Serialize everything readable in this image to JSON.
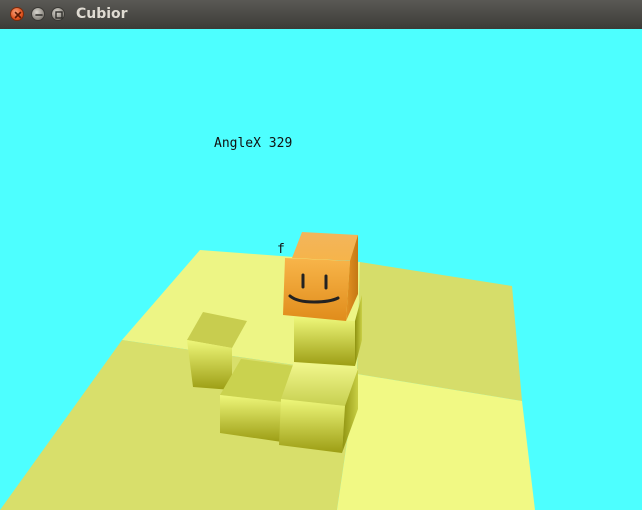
{
  "window": {
    "title": "Cubior",
    "buttons": {
      "close": "close",
      "minimize": "minimize",
      "maximize": "maximize"
    }
  },
  "hud": {
    "angle_text": "AngleX 329",
    "partial_text": "f"
  },
  "colors": {
    "sky": "#4dffff",
    "floor": "#e3ec7a",
    "player": "#f5a93b",
    "titlebar": "#3c3b37"
  },
  "icons": {
    "close": "close-icon",
    "minimize": "minimize-icon",
    "maximize": "maximize-icon"
  }
}
